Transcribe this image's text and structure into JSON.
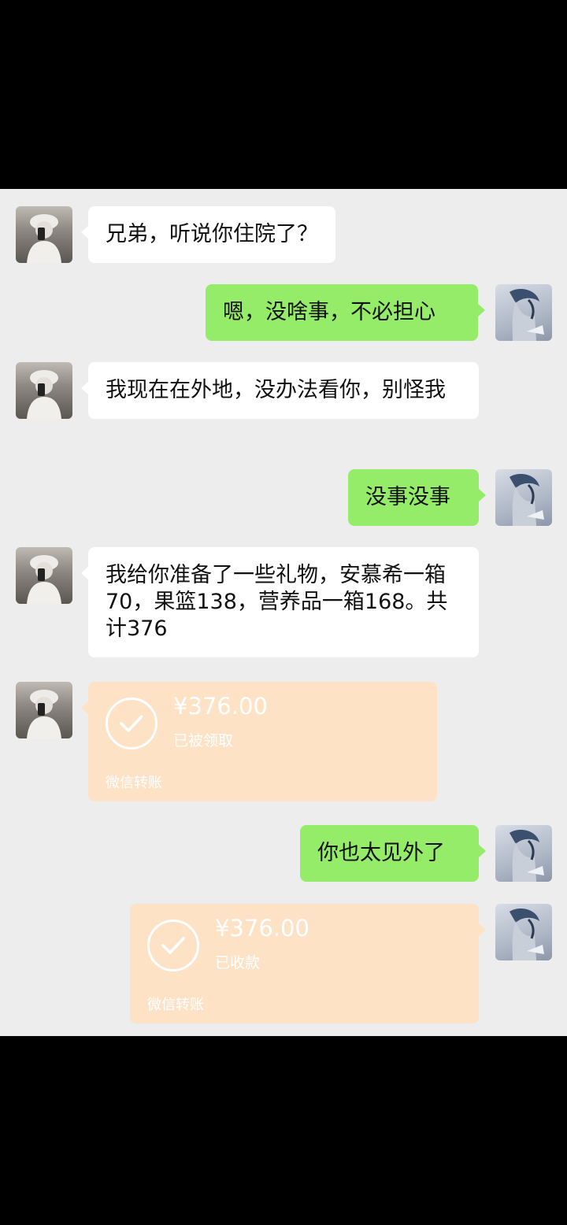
{
  "messages": [
    {
      "side": "left",
      "text": "兄弟，听说你住院了？"
    },
    {
      "side": "right",
      "text": "嗯，没啥事，不必担心"
    },
    {
      "side": "left",
      "text": "我现在在外地，没办法看你，别怪我"
    },
    {
      "side": "right",
      "text": "没事没事"
    },
    {
      "side": "left",
      "text": "我给你准备了一些礼物，安慕希一箱70，果篮138，营养品一箱168。共计376"
    },
    {
      "side": "left",
      "type": "transfer",
      "amount": "¥376.00",
      "status": "已被领取",
      "label": "微信转账"
    },
    {
      "side": "right",
      "text": "你也太见外了"
    },
    {
      "side": "right",
      "type": "transfer",
      "amount": "¥376.00",
      "status": "已收款",
      "label": "微信转账"
    }
  ],
  "colors": {
    "chat_background": "#ededed",
    "incoming_bubble": "#ffffff",
    "outgoing_bubble": "#95ec69",
    "transfer_card": "#fde2c6"
  },
  "icons": {
    "transfer_status": "check-circle-icon"
  }
}
